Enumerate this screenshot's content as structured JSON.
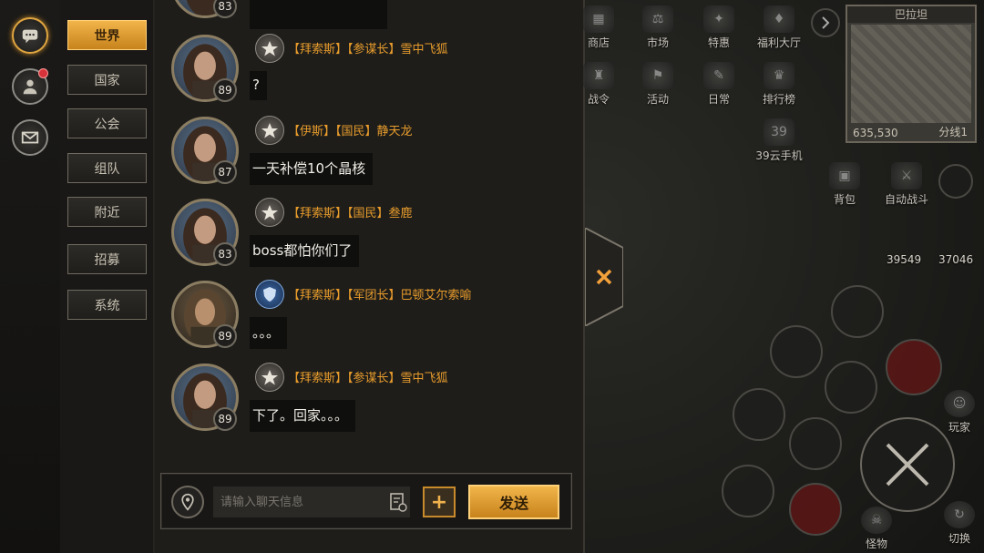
{
  "rail": {
    "chat_label": "chat",
    "profile_label": "profile",
    "mail_label": "mail"
  },
  "tabs": [
    "世界",
    "国家",
    "公会",
    "组队",
    "附近",
    "招募",
    "系统"
  ],
  "messages": [
    {
      "level": "89",
      "badge": "gray",
      "name": "【拜索斯】【参谋长】雪中飞狐",
      "text": "?"
    },
    {
      "level": "87",
      "badge": "gray",
      "name": "【伊斯】【国民】静天龙",
      "text": "一天补偿10个晶核"
    },
    {
      "level": "83",
      "badge": "gray",
      "name": "【拜索斯】【国民】叁鹿",
      "text": "boss都怕你们了"
    },
    {
      "level": "89",
      "badge": "blue",
      "name": "【拜索斯】【军团长】巴顿艾尔索喻",
      "text": "。。。"
    },
    {
      "level": "89",
      "badge": "gray",
      "name": "【拜索斯】【参谋长】雪中飞狐",
      "text": "下了。回家。。。"
    }
  ],
  "top_partial_level": "83",
  "input": {
    "placeholder": "请输入聊天信息",
    "plus_label": "+",
    "send_label": "发送"
  },
  "hud": {
    "top_row": [
      "商店",
      "市场",
      "特惠",
      "福利大厅"
    ],
    "second_row": [
      "战令",
      "活动",
      "日常",
      "排行榜"
    ],
    "phone": "39云手机",
    "bag": "背包",
    "auto_fight": "自动战斗",
    "stat_left": "39549",
    "stat_right": "37046",
    "player": "玩家",
    "monster": "怪物",
    "switch": "切换"
  },
  "minimap": {
    "title": "巴拉坦",
    "coords": "635,530",
    "line": "分线1"
  },
  "colors": {
    "accent": "#e89c2c",
    "active_tab": "#f1b54a",
    "notification": "#d8333a"
  }
}
